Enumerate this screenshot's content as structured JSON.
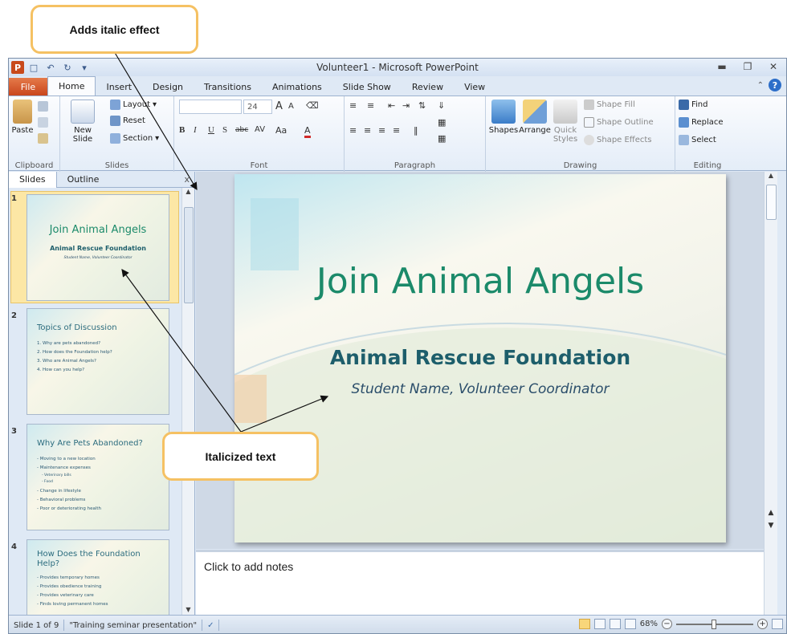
{
  "callouts": {
    "italic_effect": "Adds italic effect",
    "italicized_text": "Italicized text"
  },
  "window": {
    "title": "Volunteer1 - Microsoft PowerPoint",
    "app_icon_letter": "P"
  },
  "tabs": [
    "File",
    "Home",
    "Insert",
    "Design",
    "Transitions",
    "Animations",
    "Slide Show",
    "Review",
    "View"
  ],
  "ribbon": {
    "clipboard": {
      "paste": "Paste",
      "label": "Clipboard"
    },
    "slides": {
      "new_slide": "New Slide",
      "layout": "Layout",
      "reset": "Reset",
      "section": "Section",
      "label": "Slides"
    },
    "font": {
      "size": "24",
      "bold": "B",
      "italic": "I",
      "underline": "U",
      "shadow": "S",
      "strike": "abc",
      "spacing": "AV",
      "case": "Aa",
      "color": "A",
      "grow": "A",
      "shrink": "A",
      "label": "Font"
    },
    "paragraph": {
      "label": "Paragraph"
    },
    "drawing": {
      "shapes": "Shapes",
      "arrange": "Arrange",
      "quick_styles": "Quick Styles",
      "shape_fill": "Shape Fill",
      "shape_outline": "Shape Outline",
      "shape_effects": "Shape Effects",
      "label": "Drawing"
    },
    "editing": {
      "find": "Find",
      "replace": "Replace",
      "select": "Select",
      "label": "Editing"
    }
  },
  "pane": {
    "tab_slides": "Slides",
    "tab_outline": "Outline",
    "close": "x"
  },
  "thumbnails": [
    {
      "num": "1",
      "title": "Join Animal Angels",
      "sub": "Animal Rescue Foundation",
      "sub2": "Student Name, Volunteer Coordinator"
    },
    {
      "num": "2",
      "title": "Topics of Discussion",
      "bullets": [
        "1. Why are pets abandoned?",
        "2. How does the Foundation help?",
        "3. Who are Animal Angels?",
        "4. How can you help?"
      ]
    },
    {
      "num": "3",
      "title": "Why Are Pets Abandoned?",
      "bullets": [
        "- Moving to a new location",
        "- Maintenance expenses",
        "- Veterinary bills",
        "- Food",
        "- Change in lifestyle",
        "- Behavioral problems",
        "- Poor or deteriorating health"
      ]
    },
    {
      "num": "4",
      "title": "How Does the Foundation Help?",
      "bullets": [
        "- Provides temporary homes",
        "- Provides obedience training",
        "- Provides veterinary care",
        "- Finds loving permanent homes"
      ]
    }
  ],
  "slide": {
    "title": "Join Animal Angels",
    "subtitle": "Animal Rescue Foundation",
    "subtitle2": "Student Name, Volunteer Coordinator"
  },
  "notes": {
    "placeholder": "Click to add notes"
  },
  "status": {
    "slide_counter": "Slide 1 of 9",
    "theme": "\"Training seminar presentation\"",
    "zoom": "68%"
  },
  "colors": {
    "title_green": "#1b8a6a",
    "accent_orange": "#f5c163",
    "file_tab": "#c9461c"
  }
}
